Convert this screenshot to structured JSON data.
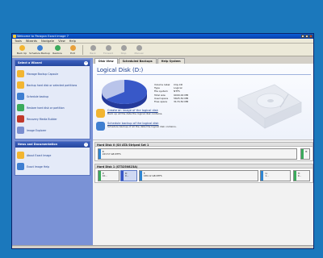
{
  "window": {
    "title": "Welcome to Paragon Exact Image 7",
    "menu": [
      "Tools",
      "Wizards",
      "Navigate",
      "View",
      "Help"
    ]
  },
  "toolbar": [
    {
      "name": "back-up",
      "label": "Back Up",
      "icon": "backup-icon",
      "color": "#f2b531",
      "disabled": false
    },
    {
      "name": "schedule-backup",
      "label": "Schedule Backup",
      "icon": "schedule-icon",
      "color": "#3f7fd1",
      "disabled": false
    },
    {
      "name": "restore",
      "label": "Restore",
      "icon": "restore-icon",
      "color": "#3bab5c",
      "disabled": false
    },
    {
      "name": "exit",
      "label": "Exit",
      "icon": "exit-icon",
      "color": "#e8a03a",
      "disabled": false
    },
    {
      "name": "back",
      "label": "Back",
      "icon": "back-icon",
      "color": "#a0a0a0",
      "disabled": true
    },
    {
      "name": "forward",
      "label": "Forward",
      "icon": "forward-icon",
      "color": "#a0a0a0",
      "disabled": true
    },
    {
      "name": "stop",
      "label": "Stop",
      "icon": "stop-icon",
      "color": "#a0a0a0",
      "disabled": true
    },
    {
      "name": "manual",
      "label": "Manual",
      "icon": "manual-icon",
      "color": "#a0a0a0",
      "disabled": true
    }
  ],
  "sidebar": {
    "wizard_title": "Select a Wizard",
    "wizards": [
      {
        "name": "manage-backup-capsule",
        "label": "Manage Backup Capsule",
        "color": "#f2b531"
      },
      {
        "name": "backup-hard-disk",
        "label": "Backup hard disk or selected partitions",
        "color": "#f2b531"
      },
      {
        "name": "schedule-backup",
        "label": "Schedule backup",
        "color": "#3f7fd1"
      },
      {
        "name": "restore-hard-disk",
        "label": "Restore hard disk or partition",
        "color": "#3bab5c"
      },
      {
        "name": "recovery-media-builder",
        "label": "Recovery Media Builder",
        "color": "#c0382b"
      },
      {
        "name": "image-explorer",
        "label": "Image Explorer",
        "color": "#7a8ed0"
      }
    ],
    "news_title": "News and Documentation",
    "news": [
      {
        "name": "about-exact-image",
        "label": "About Exact Image",
        "color": "#f2b531"
      },
      {
        "name": "exact-image-help",
        "label": "Exact Image Help",
        "color": "#3f7fd1"
      }
    ]
  },
  "tabs": [
    "Disk View",
    "Scheduled Backups",
    "Help System"
  ],
  "disk_info": {
    "title": "Logical Disk (D:)",
    "properties": [
      {
        "key": "Volume label",
        "value": "Clip-CD"
      },
      {
        "key": "Type",
        "value": "Logical"
      },
      {
        "key": "File system",
        "value": "NTFS"
      },
      {
        "key": "Total size",
        "value": "9000.00 MB"
      },
      {
        "key": "Used space",
        "value": "5825.50 MB"
      },
      {
        "key": "Free space",
        "value": "3174.50 MB"
      }
    ],
    "used_fraction": 0.647,
    "used_color": "#3858c8",
    "free_color": "#b9c4ea",
    "actions": [
      {
        "name": "create-image-action",
        "title": "Create an image of the logical disk",
        "desc": "Back up all the data the logical disk contains."
      },
      {
        "name": "schedule-backup-action",
        "title": "Schedule backup of the logical disk",
        "desc": "Schedule backup of all the data the logical disk contains."
      }
    ]
  },
  "disks": [
    {
      "name": "disk-0",
      "title": "Hard Disk 0 (SiI ATA Striped Set 1",
      "parts": [
        {
          "label1": "E:",
          "label2": "223.57 GB NTFS",
          "color": "#2f86d2",
          "start": 0.01,
          "width": 0.92,
          "selected": false
        },
        {
          "label1": "B:",
          "label2": "",
          "color": "#3bab5c",
          "start": 0.945,
          "width": 0.045,
          "selected": false
        }
      ]
    },
    {
      "name": "disk-1",
      "title": "Hard Disk 1 (ST3250823A)",
      "parts": [
        {
          "label1": "P:",
          "label2": "10...",
          "color": "#3bab5c",
          "start": 0.01,
          "width": 0.1,
          "selected": false
        },
        {
          "label1": "D:",
          "label2": "9...",
          "color": "#3858c8",
          "start": 0.115,
          "width": 0.08,
          "selected": true
        },
        {
          "label1": "F:",
          "label2": "165.12 GB NTFS",
          "color": "#2f86d2",
          "start": 0.2,
          "width": 0.55,
          "selected": false
        },
        {
          "label1": "G:",
          "label2": "1...",
          "color": "#2f86d2",
          "start": 0.76,
          "width": 0.14,
          "selected": false
        },
        {
          "label1": "H:",
          "label2": "9...",
          "color": "#3bab5c",
          "start": 0.91,
          "width": 0.08,
          "selected": false
        }
      ]
    }
  ]
}
